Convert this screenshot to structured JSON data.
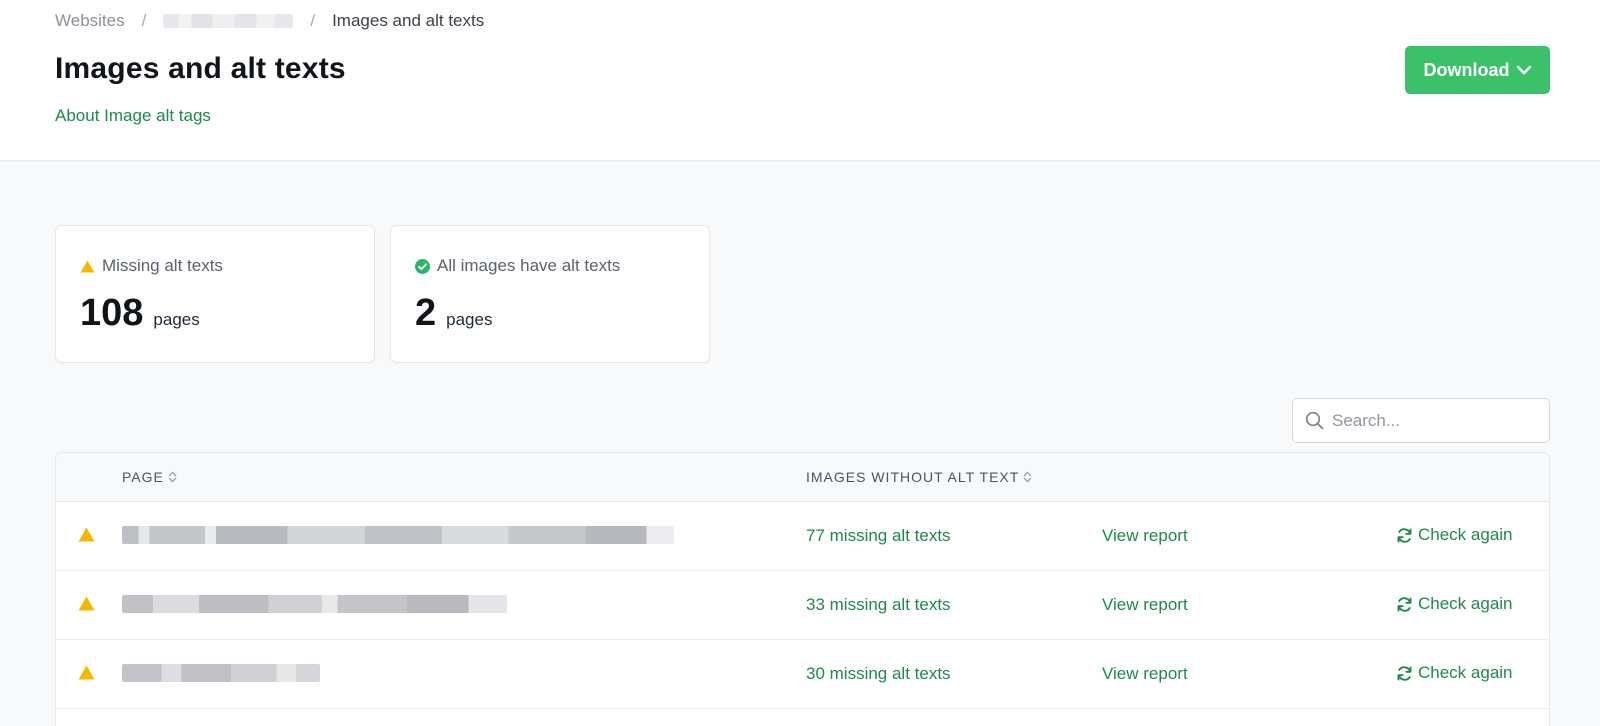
{
  "breadcrumb": {
    "root": "Websites",
    "separator": "/",
    "current": "Images and alt texts"
  },
  "page_title": "Images and alt texts",
  "about_link": "About Image alt tags",
  "download_label": "Download",
  "cards": [
    {
      "label": "Missing alt texts",
      "value": "108",
      "unit": "pages",
      "icon": "warning-triangle-icon",
      "color": "#f5b800"
    },
    {
      "label": "All images have alt texts",
      "value": "2",
      "unit": "pages",
      "icon": "check-circle-icon",
      "color": "#2fb26a"
    }
  ],
  "search": {
    "placeholder": "Search..."
  },
  "table": {
    "columns": [
      "PAGE",
      "IMAGES WITHOUT ALT TEXT"
    ],
    "rows": [
      {
        "missing": "77 missing alt texts",
        "view": "View report",
        "check": "Check again"
      },
      {
        "missing": "33 missing alt texts",
        "view": "View report",
        "check": "Check again"
      },
      {
        "missing": "30 missing alt texts",
        "view": "View report",
        "check": "Check again"
      }
    ]
  },
  "colors": {
    "accent_green": "#3cc16b",
    "link_green": "#1e8a4a",
    "warning_yellow": "#f5b800"
  }
}
